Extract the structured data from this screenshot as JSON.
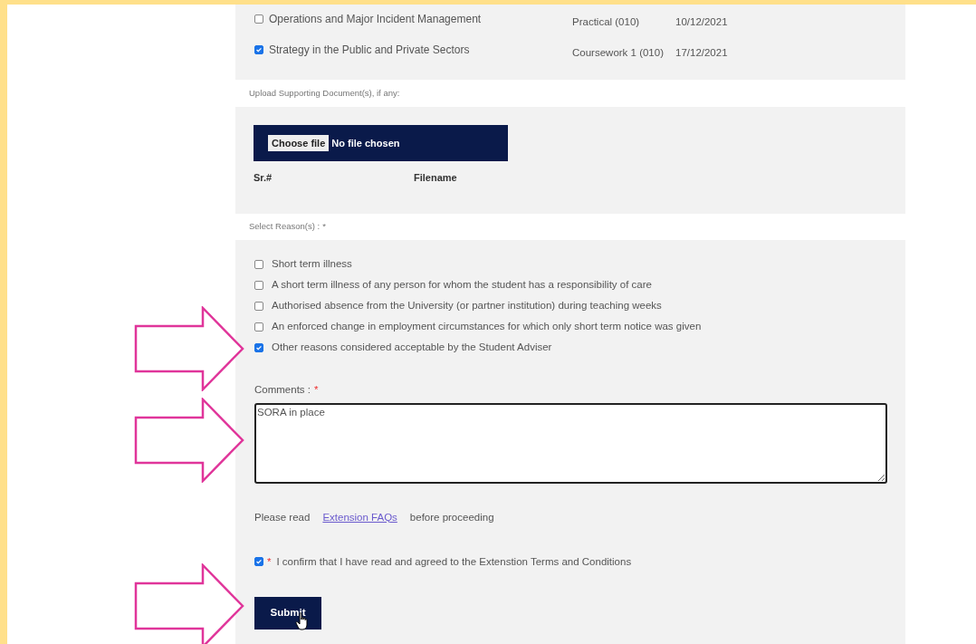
{
  "modules": [
    {
      "name": "Operations and Major Incident Management",
      "checked": false,
      "assessment": "Practical (010)",
      "date": "10/12/2021"
    },
    {
      "name": "Strategy in the Public and Private Sectors",
      "checked": true,
      "assessment": "Coursework 1 (010)",
      "date": "17/12/2021"
    }
  ],
  "upload": {
    "label": "Upload Supporting Document(s), if any:",
    "button": "Choose file",
    "status": "No file chosen",
    "columns": [
      "Sr.#",
      "Filename"
    ]
  },
  "reasons": {
    "label": "Select Reason(s) :",
    "required": "*",
    "items": [
      {
        "label": "Short term illness",
        "checked": false
      },
      {
        "label": "A short term illness of any person for whom the student has a responsibility of care",
        "checked": false
      },
      {
        "label": "Authorised absence from the University (or partner institution) during teaching weeks",
        "checked": false
      },
      {
        "label": "An enforced change in employment circumstances for which only short term notice was given",
        "checked": false
      },
      {
        "label": "Other reasons considered acceptable by the Student Adviser",
        "checked": true
      }
    ]
  },
  "comments": {
    "label": "Comments :",
    "required": "*",
    "value": "SORA in place"
  },
  "faq": {
    "before": "Please read",
    "link": "Extension FAQs",
    "after": "before proceeding"
  },
  "confirm": {
    "checked": true,
    "required": "*",
    "label": "I confirm that I have read and agreed to the Extenstion Terms and Conditions"
  },
  "submit": "Submit"
}
